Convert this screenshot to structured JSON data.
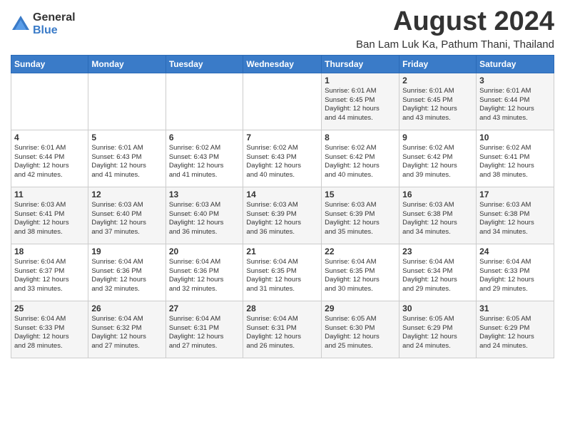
{
  "header": {
    "logo_general": "General",
    "logo_blue": "Blue",
    "month_year": "August 2024",
    "location": "Ban Lam Luk Ka, Pathum Thani, Thailand"
  },
  "days_of_week": [
    "Sunday",
    "Monday",
    "Tuesday",
    "Wednesday",
    "Thursday",
    "Friday",
    "Saturday"
  ],
  "weeks": [
    [
      {
        "num": "",
        "detail": ""
      },
      {
        "num": "",
        "detail": ""
      },
      {
        "num": "",
        "detail": ""
      },
      {
        "num": "",
        "detail": ""
      },
      {
        "num": "1",
        "detail": "Sunrise: 6:01 AM\nSunset: 6:45 PM\nDaylight: 12 hours\nand 44 minutes."
      },
      {
        "num": "2",
        "detail": "Sunrise: 6:01 AM\nSunset: 6:45 PM\nDaylight: 12 hours\nand 43 minutes."
      },
      {
        "num": "3",
        "detail": "Sunrise: 6:01 AM\nSunset: 6:44 PM\nDaylight: 12 hours\nand 43 minutes."
      }
    ],
    [
      {
        "num": "4",
        "detail": "Sunrise: 6:01 AM\nSunset: 6:44 PM\nDaylight: 12 hours\nand 42 minutes."
      },
      {
        "num": "5",
        "detail": "Sunrise: 6:01 AM\nSunset: 6:43 PM\nDaylight: 12 hours\nand 41 minutes."
      },
      {
        "num": "6",
        "detail": "Sunrise: 6:02 AM\nSunset: 6:43 PM\nDaylight: 12 hours\nand 41 minutes."
      },
      {
        "num": "7",
        "detail": "Sunrise: 6:02 AM\nSunset: 6:43 PM\nDaylight: 12 hours\nand 40 minutes."
      },
      {
        "num": "8",
        "detail": "Sunrise: 6:02 AM\nSunset: 6:42 PM\nDaylight: 12 hours\nand 40 minutes."
      },
      {
        "num": "9",
        "detail": "Sunrise: 6:02 AM\nSunset: 6:42 PM\nDaylight: 12 hours\nand 39 minutes."
      },
      {
        "num": "10",
        "detail": "Sunrise: 6:02 AM\nSunset: 6:41 PM\nDaylight: 12 hours\nand 38 minutes."
      }
    ],
    [
      {
        "num": "11",
        "detail": "Sunrise: 6:03 AM\nSunset: 6:41 PM\nDaylight: 12 hours\nand 38 minutes."
      },
      {
        "num": "12",
        "detail": "Sunrise: 6:03 AM\nSunset: 6:40 PM\nDaylight: 12 hours\nand 37 minutes."
      },
      {
        "num": "13",
        "detail": "Sunrise: 6:03 AM\nSunset: 6:40 PM\nDaylight: 12 hours\nand 36 minutes."
      },
      {
        "num": "14",
        "detail": "Sunrise: 6:03 AM\nSunset: 6:39 PM\nDaylight: 12 hours\nand 36 minutes."
      },
      {
        "num": "15",
        "detail": "Sunrise: 6:03 AM\nSunset: 6:39 PM\nDaylight: 12 hours\nand 35 minutes."
      },
      {
        "num": "16",
        "detail": "Sunrise: 6:03 AM\nSunset: 6:38 PM\nDaylight: 12 hours\nand 34 minutes."
      },
      {
        "num": "17",
        "detail": "Sunrise: 6:03 AM\nSunset: 6:38 PM\nDaylight: 12 hours\nand 34 minutes."
      }
    ],
    [
      {
        "num": "18",
        "detail": "Sunrise: 6:04 AM\nSunset: 6:37 PM\nDaylight: 12 hours\nand 33 minutes."
      },
      {
        "num": "19",
        "detail": "Sunrise: 6:04 AM\nSunset: 6:36 PM\nDaylight: 12 hours\nand 32 minutes."
      },
      {
        "num": "20",
        "detail": "Sunrise: 6:04 AM\nSunset: 6:36 PM\nDaylight: 12 hours\nand 32 minutes."
      },
      {
        "num": "21",
        "detail": "Sunrise: 6:04 AM\nSunset: 6:35 PM\nDaylight: 12 hours\nand 31 minutes."
      },
      {
        "num": "22",
        "detail": "Sunrise: 6:04 AM\nSunset: 6:35 PM\nDaylight: 12 hours\nand 30 minutes."
      },
      {
        "num": "23",
        "detail": "Sunrise: 6:04 AM\nSunset: 6:34 PM\nDaylight: 12 hours\nand 29 minutes."
      },
      {
        "num": "24",
        "detail": "Sunrise: 6:04 AM\nSunset: 6:33 PM\nDaylight: 12 hours\nand 29 minutes."
      }
    ],
    [
      {
        "num": "25",
        "detail": "Sunrise: 6:04 AM\nSunset: 6:33 PM\nDaylight: 12 hours\nand 28 minutes."
      },
      {
        "num": "26",
        "detail": "Sunrise: 6:04 AM\nSunset: 6:32 PM\nDaylight: 12 hours\nand 27 minutes."
      },
      {
        "num": "27",
        "detail": "Sunrise: 6:04 AM\nSunset: 6:31 PM\nDaylight: 12 hours\nand 27 minutes."
      },
      {
        "num": "28",
        "detail": "Sunrise: 6:04 AM\nSunset: 6:31 PM\nDaylight: 12 hours\nand 26 minutes."
      },
      {
        "num": "29",
        "detail": "Sunrise: 6:05 AM\nSunset: 6:30 PM\nDaylight: 12 hours\nand 25 minutes."
      },
      {
        "num": "30",
        "detail": "Sunrise: 6:05 AM\nSunset: 6:29 PM\nDaylight: 12 hours\nand 24 minutes."
      },
      {
        "num": "31",
        "detail": "Sunrise: 6:05 AM\nSunset: 6:29 PM\nDaylight: 12 hours\nand 24 minutes."
      }
    ]
  ]
}
